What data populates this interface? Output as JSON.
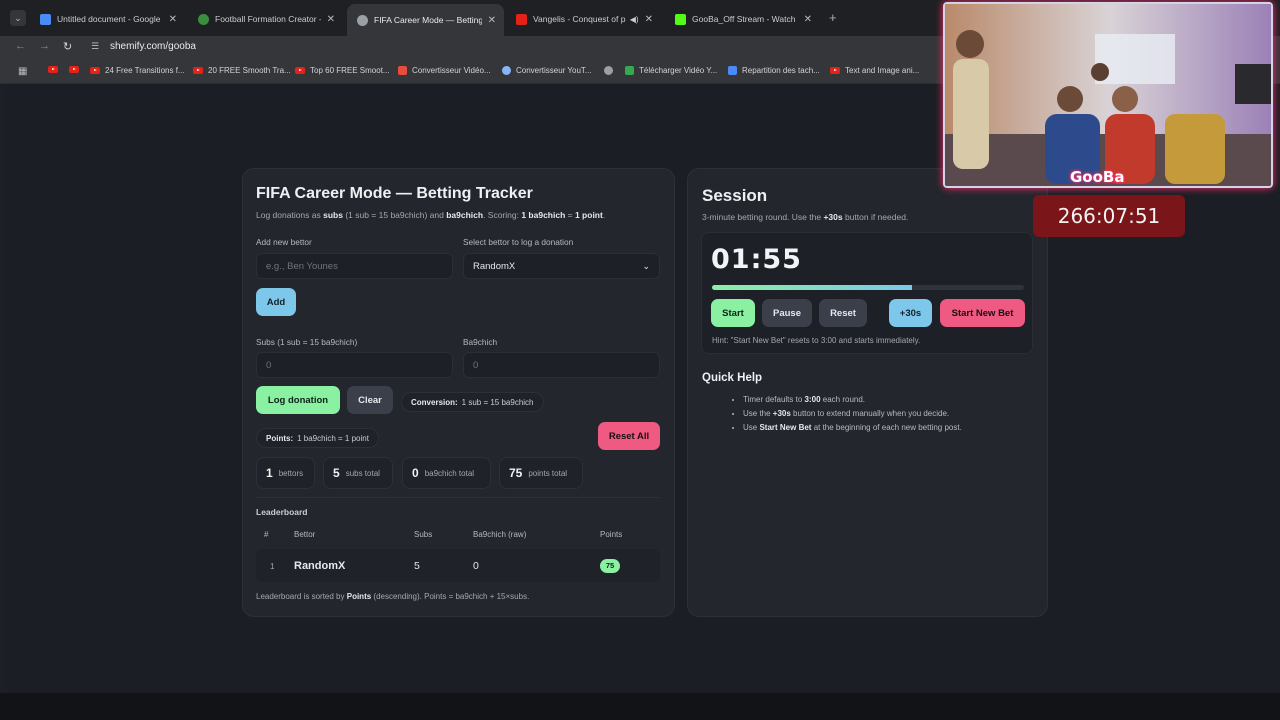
{
  "browser": {
    "tabs": [
      {
        "title": "Untitled document - Google Do",
        "color": "#4a8cf7"
      },
      {
        "title": "Football Formation Creator - M",
        "color": "#3a8f3e"
      },
      {
        "title": "FIFA Career Mode — Betting Tr",
        "color": "#9aa0a6"
      },
      {
        "title": "Vangelis - Conquest of para",
        "color": "#e62117"
      },
      {
        "title": "GooBa_Off Stream - Watch Live",
        "color": "#53fc18"
      }
    ],
    "url": "shemify.com/gooba",
    "bookmarks": [
      {
        "label": "",
        "type": "yt"
      },
      {
        "label": "",
        "type": "yt"
      },
      {
        "label": "24 Free Transitions f...",
        "type": "yt"
      },
      {
        "label": "20 FREE Smooth Tra...",
        "type": "yt"
      },
      {
        "label": "Top 60 FREE Smoot...",
        "type": "yt"
      },
      {
        "label": "Convertisseur Vidéo...",
        "type": "z"
      },
      {
        "label": "Convertisseur YouT...",
        "type": "cv"
      },
      {
        "label": "",
        "type": "globe"
      },
      {
        "label": "Télécharger Vidéo Y...",
        "type": "dl"
      },
      {
        "label": "Repartition des tach...",
        "type": "doc"
      },
      {
        "label": "Text and Image ani...",
        "type": "yt"
      }
    ]
  },
  "tracker": {
    "title": "FIFA Career Mode — Betting Tracker",
    "subtitle_parts": [
      "Log donations as ",
      "subs",
      " (1 sub = 15 ba9chich) and ",
      "ba9chich",
      ". Scoring: ",
      "1 ba9chich",
      " = ",
      "1 point",
      "."
    ],
    "add_bettor_label": "Add new bettor",
    "add_bettor_placeholder": "e.g., Ben Younes",
    "select_label": "Select bettor to log a donation",
    "select_value": "RandomX",
    "add_button": "Add",
    "subs_label": "Subs (1 sub = 15 ba9chich)",
    "subs_placeholder": "0",
    "ba9chich_label": "Ba9chich",
    "ba9chich_placeholder": "0",
    "log_button": "Log donation",
    "clear_button": "Clear",
    "conversion_key": "Conversion:",
    "conversion_val": "1 sub = 15 ba9chich",
    "points_key": "Points:",
    "points_val": "1 ba9chich = 1 point",
    "reset_all_button": "Reset All",
    "stats": [
      {
        "n": "1",
        "t": "bettors"
      },
      {
        "n": "5",
        "t": "subs total"
      },
      {
        "n": "0",
        "t": "ba9chich total"
      },
      {
        "n": "75",
        "t": "points total"
      }
    ],
    "leaderboard_title": "Leaderboard",
    "columns": [
      "#",
      "Bettor",
      "Subs",
      "Ba9chich (raw)",
      "Points"
    ],
    "rows": [
      {
        "rank": "1",
        "bettor": "RandomX",
        "subs": "5",
        "ba9chich": "0",
        "points": "75"
      }
    ],
    "footer_parts": [
      "Leaderboard is sorted by ",
      "Points",
      " (descending). Points = ba9chich + 15×subs."
    ]
  },
  "session": {
    "title": "Session",
    "subtitle_parts": [
      "3-minute betting round. Use the ",
      "+30s",
      " button if needed."
    ],
    "timer": "01:55",
    "progress": 0.64,
    "buttons": {
      "start": "Start",
      "pause": "Pause",
      "reset": "Reset",
      "plus30": "+30s",
      "new_bet": "Start New Bet"
    },
    "hint": "Hint: \"Start New Bet\" resets to 3:00 and starts immediately.",
    "quick_help_title": "Quick Help",
    "help": [
      [
        "Timer defaults to ",
        "3:00",
        " each round."
      ],
      [
        "Use the ",
        "+30s",
        " button to extend manually when you decide."
      ],
      [
        "Use ",
        "Start New Bet",
        " at the beginning of each new betting post."
      ]
    ]
  },
  "stream": {
    "tag": "GooBa",
    "timer": "266:07:51"
  }
}
